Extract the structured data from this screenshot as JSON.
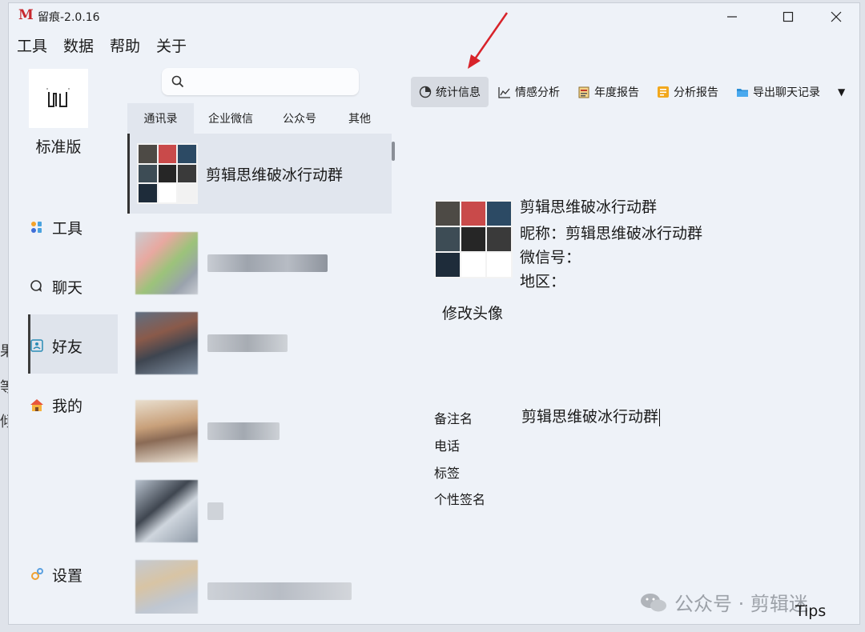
{
  "window": {
    "title": "留痕-2.0.16",
    "logo_letter": "M"
  },
  "window_controls": {
    "minimize": "—",
    "maximize": "☐",
    "close": "✕"
  },
  "menu": [
    "工具",
    "数据",
    "帮助",
    "关于"
  ],
  "sidebar": {
    "edition": "标准版",
    "nav": [
      {
        "label": "工具",
        "icon": "tools-icon"
      },
      {
        "label": "聊天",
        "icon": "chat-icon"
      },
      {
        "label": "好友",
        "icon": "contacts-icon",
        "active": true
      },
      {
        "label": "我的",
        "icon": "home-icon"
      },
      {
        "label": "设置",
        "icon": "settings-icon"
      }
    ]
  },
  "search": {
    "placeholder": ""
  },
  "tabs": [
    "通讯录",
    "企业微信",
    "公众号",
    "其他"
  ],
  "contacts": {
    "selected_name": "剪辑思维破冰行动群"
  },
  "toolbar": {
    "items": [
      {
        "label": "统计信息",
        "icon": "pie-chart-icon",
        "active": true
      },
      {
        "label": "情感分析",
        "icon": "line-chart-icon"
      },
      {
        "label": "年度报告",
        "icon": "report-icon"
      },
      {
        "label": "分析报告",
        "icon": "analysis-icon"
      },
      {
        "label": "导出聊天记录",
        "icon": "folder-icon"
      }
    ],
    "more": "▼"
  },
  "detail": {
    "title": "剪辑思维破冰行动群",
    "nickname_line": "昵称：剪辑思维破冰行动群",
    "wechat_line": "微信号：",
    "region_line": "地区：",
    "change_avatar": "修改头像",
    "fields": {
      "remark_label": "备注名",
      "remark_value": "剪辑思维破冰行动群",
      "phone_label": "电话",
      "tag_label": "标签",
      "signature_label": "个性签名"
    }
  },
  "watermark": {
    "text": "公众号 · 剪辑迷"
  },
  "tips": "Tips",
  "background_text": [
    "果",
    "等",
    "倾"
  ],
  "colors": {
    "accent_red": "#d8232a",
    "window_bg": "#eef2f8",
    "active_bg": "#e1e6ee"
  }
}
